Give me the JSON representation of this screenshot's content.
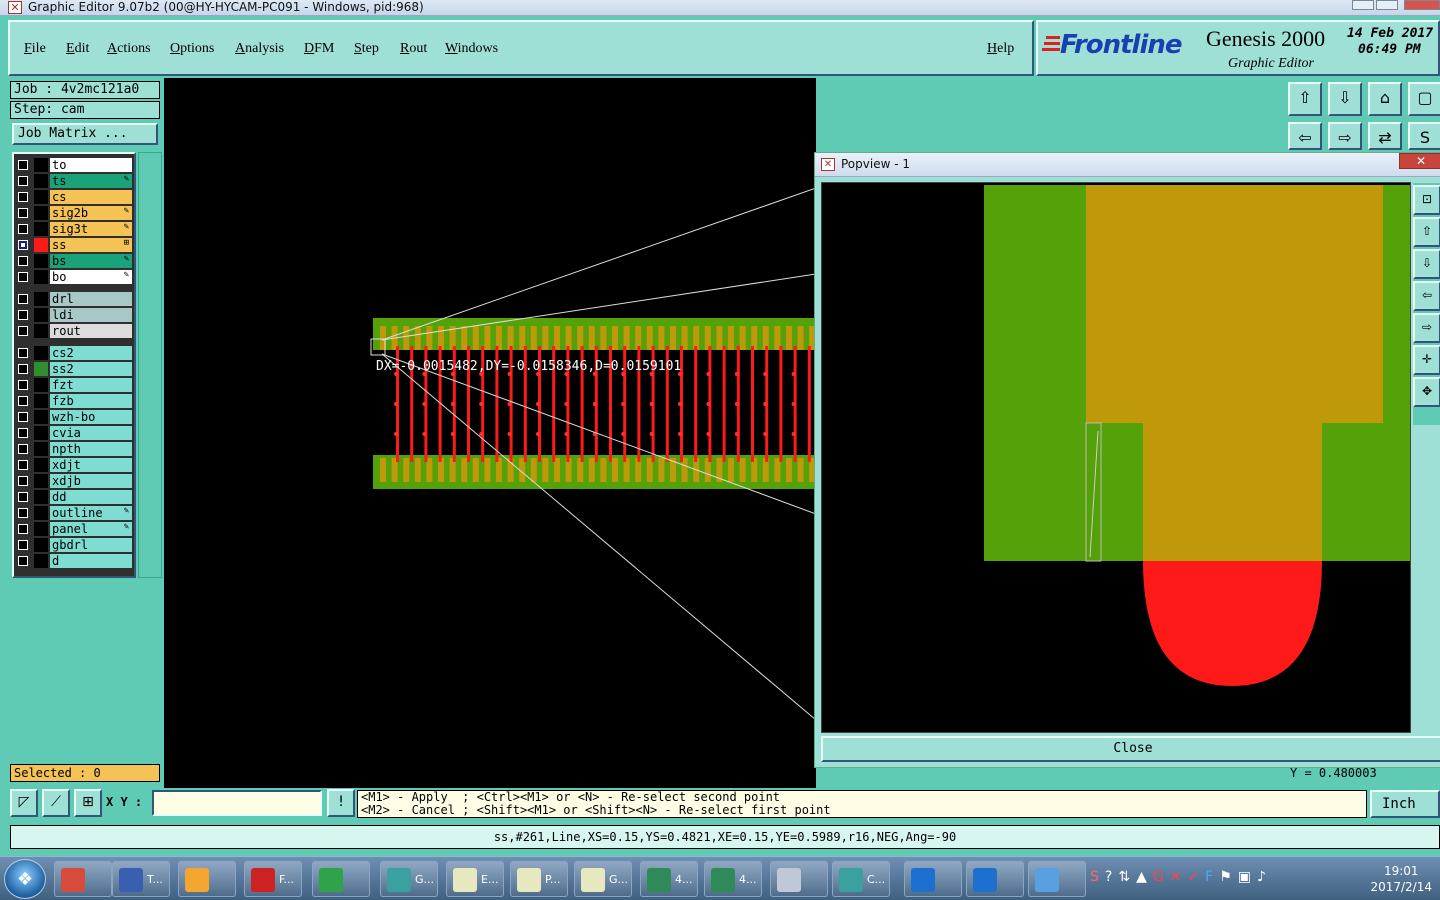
{
  "window": {
    "title": "Graphic Editor 9.07b2 (00@HY-HYCAM-PC091 - Windows, pid:968)"
  },
  "menu": [
    "File",
    "Edit",
    "Actions",
    "Options",
    "Analysis",
    "DFM",
    "Step",
    "Rout",
    "Windows"
  ],
  "help_label": "Help",
  "brand": {
    "logo": "Frontline",
    "product": "Genesis 2000",
    "subtitle": "Graphic Editor",
    "date": "14 Feb 2017",
    "time": "06:49 PM"
  },
  "job": {
    "job_label": "Job : 4v2mc121a0",
    "step_label": "Step: cam",
    "matrix_button": "Job Matrix ..."
  },
  "layers": [
    {
      "name": "to",
      "color": "#ffffff",
      "swatch": "#000000",
      "tag": "",
      "active": false
    },
    {
      "name": "ts",
      "color": "#1aa37a",
      "swatch": "#000000",
      "tag": "✎",
      "active": false
    },
    {
      "name": "cs",
      "color": "#f5c255",
      "swatch": "#000000",
      "tag": "",
      "active": false
    },
    {
      "name": "sig2b",
      "color": "#f5c255",
      "swatch": "#000000",
      "tag": "✎",
      "active": false
    },
    {
      "name": "sig3t",
      "color": "#f5c255",
      "swatch": "#000000",
      "tag": "✎",
      "active": false
    },
    {
      "name": "ss",
      "color": "#f5c255",
      "swatch": "#ff1a1a",
      "tag": "⊞",
      "active": true
    },
    {
      "name": "bs",
      "color": "#1aa37a",
      "swatch": "#000000",
      "tag": "✎",
      "active": false
    },
    {
      "name": "bo",
      "color": "#ffffff",
      "swatch": "#000000",
      "tag": "✎",
      "active": false
    },
    {
      "name": "drl",
      "color": "#a8c8c8",
      "swatch": "#000000",
      "tag": "",
      "active": false,
      "gap": true
    },
    {
      "name": "ldi",
      "color": "#a8c8c8",
      "swatch": "#000000",
      "tag": "",
      "active": false
    },
    {
      "name": "rout",
      "color": "#dcdcdc",
      "swatch": "#000000",
      "tag": "",
      "active": false
    },
    {
      "name": "cs2",
      "color": "#7fdcd0",
      "swatch": "#000000",
      "tag": "",
      "active": false,
      "gap": true
    },
    {
      "name": "ss2",
      "color": "#7fdcd0",
      "swatch": "#2f8f2f",
      "tag": "",
      "active": false
    },
    {
      "name": "fzt",
      "color": "#7fdcd0",
      "swatch": "#000000",
      "tag": "",
      "active": false
    },
    {
      "name": "fzb",
      "color": "#7fdcd0",
      "swatch": "#000000",
      "tag": "",
      "active": false
    },
    {
      "name": "wzh-bo",
      "color": "#7fdcd0",
      "swatch": "#000000",
      "tag": "",
      "active": false
    },
    {
      "name": "cvia",
      "color": "#7fdcd0",
      "swatch": "#000000",
      "tag": "",
      "active": false
    },
    {
      "name": "npth",
      "color": "#7fdcd0",
      "swatch": "#000000",
      "tag": "",
      "active": false
    },
    {
      "name": "xdjt",
      "color": "#7fdcd0",
      "swatch": "#000000",
      "tag": "",
      "active": false
    },
    {
      "name": "xdjb",
      "color": "#7fdcd0",
      "swatch": "#000000",
      "tag": "",
      "active": false
    },
    {
      "name": "dd",
      "color": "#7fdcd0",
      "swatch": "#000000",
      "tag": "",
      "active": false
    },
    {
      "name": "outline",
      "color": "#7fdcd0",
      "swatch": "#000000",
      "tag": "✎",
      "active": false
    },
    {
      "name": "panel",
      "color": "#7fdcd0",
      "swatch": "#000000",
      "tag": "✎",
      "active": false
    },
    {
      "name": "gbdrl",
      "color": "#7fdcd0",
      "swatch": "#000000",
      "tag": "",
      "active": false
    },
    {
      "name": "d",
      "color": "#7fdcd0",
      "swatch": "#000000",
      "tag": "",
      "active": false
    }
  ],
  "measure_text": "DX=-0.0015482,DY=-0.0158346,D=0.0159101",
  "popview": {
    "title": "Popview - 1",
    "close_label": "Close",
    "close_x": "✕"
  },
  "partial_readout": "Y = 0.480003",
  "selected_label": "Selected : 0",
  "xy_label": "X Y :",
  "xy_value": "",
  "prompt_line1": "<M1> - Apply  ; <Ctrl><M1> or <N> - Re-select second point",
  "prompt_line2": "<M2> - Cancel ; <Shift><M1> or <Shift><N> - Re-select first point",
  "units": "Inch",
  "status": "ss,#261,Line,XS=0.15,YS=0.4821,XE=0.15,YE=0.5989,r16,NEG,Ang=-90",
  "taskbar": {
    "items": [
      {
        "label": "",
        "color": "#d64b3b"
      },
      {
        "label": "T...",
        "color": "#3a5fb0"
      },
      {
        "label": "",
        "color": "#f3a530"
      },
      {
        "label": "F...",
        "color": "#cc2222"
      },
      {
        "label": "",
        "color": "#2fa34a"
      },
      {
        "label": "G...",
        "color": "#3aa0a0"
      },
      {
        "label": "E...",
        "color": "#e8e8c0"
      },
      {
        "label": "P...",
        "color": "#e8e8c0"
      },
      {
        "label": "G...",
        "color": "#e8e8c0"
      },
      {
        "label": "4...",
        "color": "#2e8b57"
      },
      {
        "label": "4...",
        "color": "#2e8b57"
      },
      {
        "label": "",
        "color": "#c0c8d8"
      },
      {
        "label": "C...",
        "color": "#3aa0a0"
      },
      {
        "label": "",
        "color": "#1d6fd0"
      },
      {
        "label": "",
        "color": "#1d6fd0"
      },
      {
        "label": "",
        "color": "#5aa0e0"
      }
    ],
    "time": "19:01",
    "date": "2017/2/14"
  }
}
